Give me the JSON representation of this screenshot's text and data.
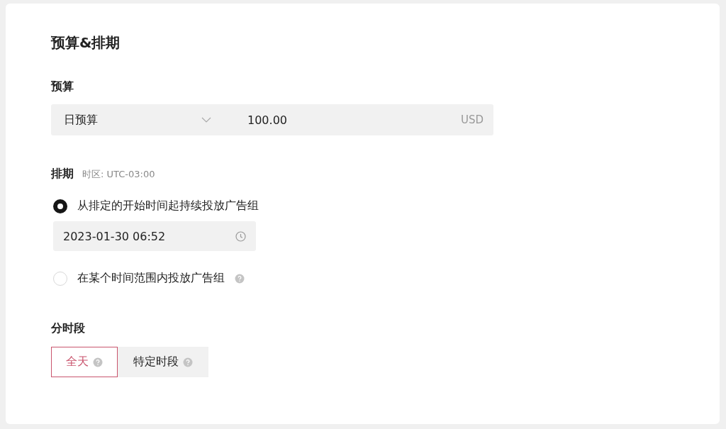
{
  "title": "预算&排期",
  "budget": {
    "label": "预算",
    "type_select": {
      "value": "日预算"
    },
    "amount": {
      "value": "100.00",
      "unit": "USD"
    }
  },
  "schedule": {
    "label": "排期",
    "timezone": "时区: UTC-03:00",
    "options": [
      {
        "label": "从排定的开始时间起持续投放广告组",
        "selected": true,
        "help": false,
        "start": {
          "value": "2023-01-30 06:52"
        }
      },
      {
        "label": "在某个时间范围内投放广告组",
        "selected": false,
        "help": true
      }
    ]
  },
  "dayparting": {
    "label": "分时段",
    "options": [
      {
        "label": "全天",
        "selected": true
      },
      {
        "label": "特定时段",
        "selected": false
      }
    ]
  }
}
